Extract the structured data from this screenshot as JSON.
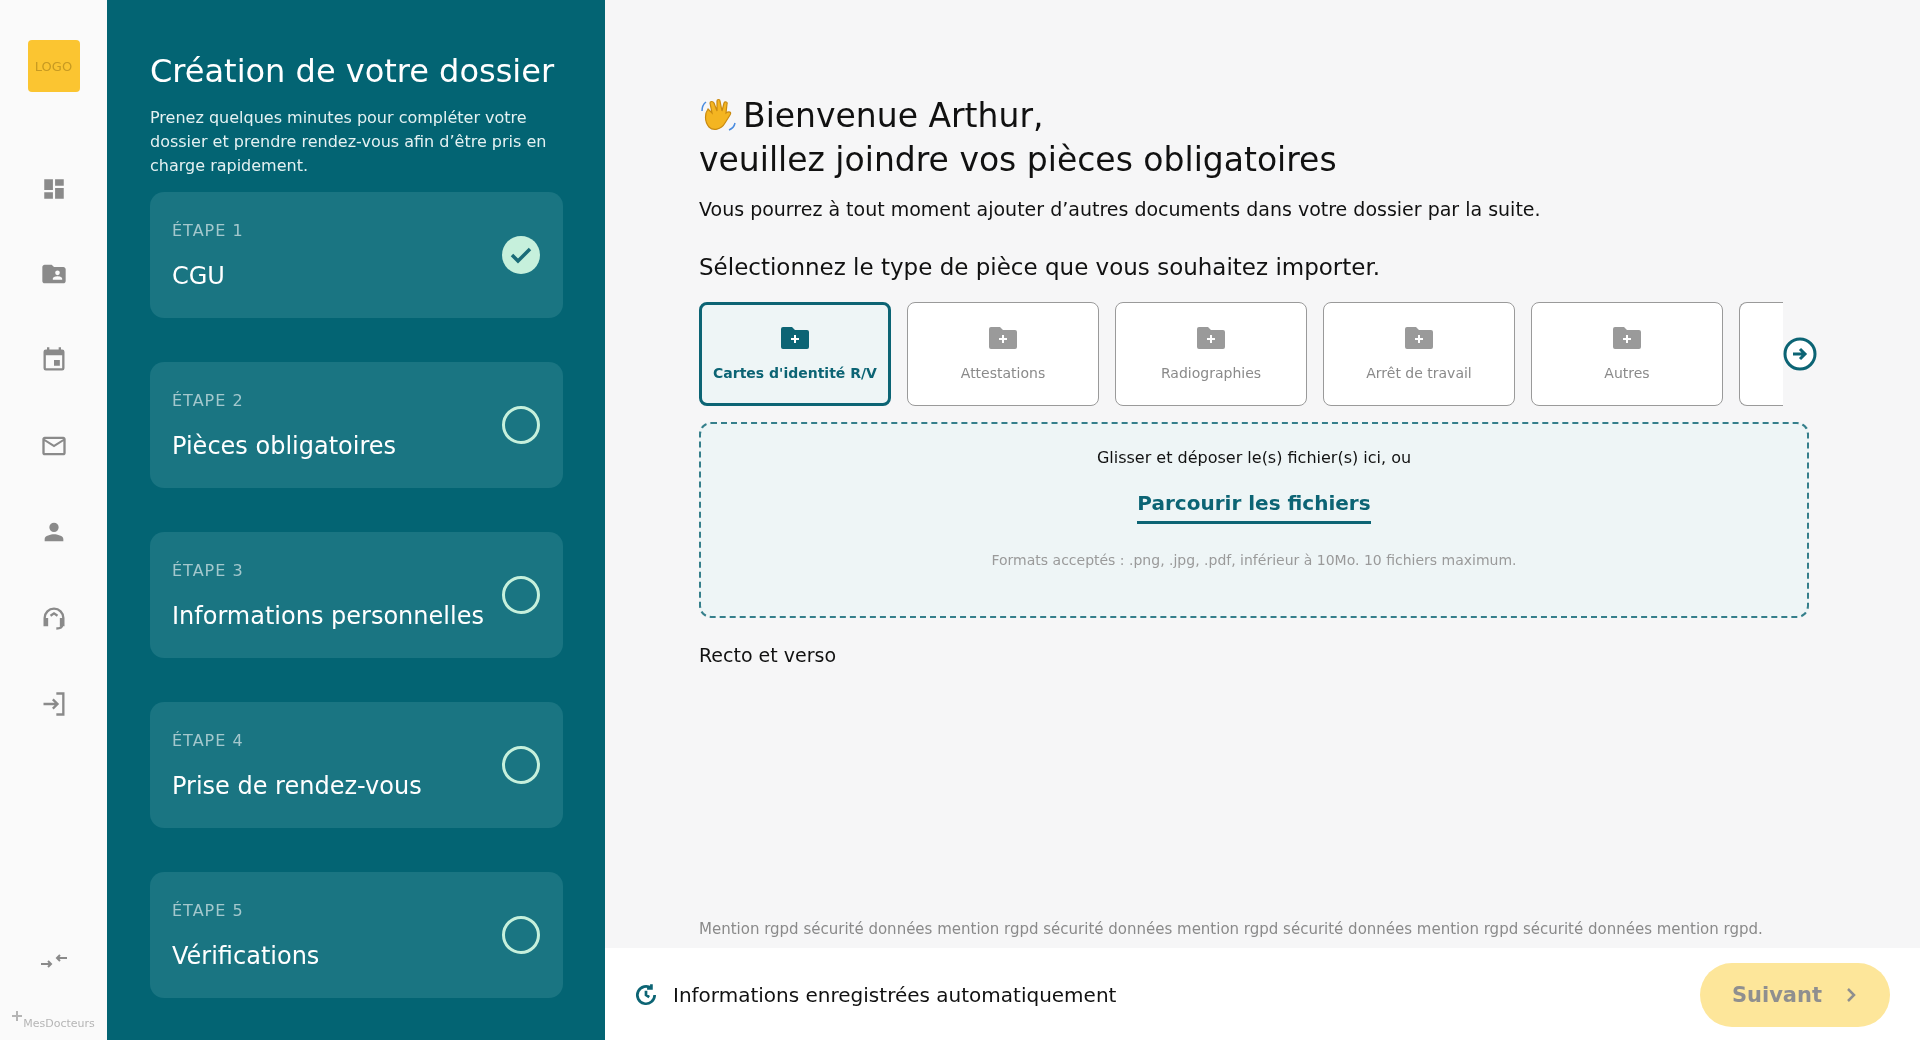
{
  "rail": {
    "logo": "LOGO",
    "brand": "MesDocteurs"
  },
  "steps_panel": {
    "title": "Création de votre dossier",
    "intro": "Prenez quelques minutes pour compléter votre dossier et prendre rendez-vous afin d’être pris en charge rapidement.",
    "steps": [
      {
        "label": "ÉTAPE 1",
        "name": "CGU",
        "checked": true
      },
      {
        "label": "ÉTAPE 2",
        "name": "Pièces obligatoires",
        "checked": false
      },
      {
        "label": "ÉTAPE 3",
        "name": "Informations personnelles",
        "checked": false
      },
      {
        "label": "ÉTAPE 4",
        "name": "Prise de rendez-vous",
        "checked": false
      },
      {
        "label": "ÉTAPE 5",
        "name": "Vérifications",
        "checked": false
      }
    ]
  },
  "main": {
    "greeting": "Bienvenue Arthur,",
    "heading": "veuillez joindre vos pièces obligatoires",
    "subtitle": "Vous pourrez à tout moment ajouter d’autres documents dans votre dossier par la suite.",
    "prompt": "Sélectionnez le type de pièce que vous souhaitez importer.",
    "doc_types": [
      {
        "label": "Cartes d'identité R/V",
        "selected": true
      },
      {
        "label": "Attestations",
        "selected": false
      },
      {
        "label": "Radiographies",
        "selected": false
      },
      {
        "label": "Arrêt de travail",
        "selected": false
      },
      {
        "label": "Autres",
        "selected": false
      }
    ],
    "dropzone": {
      "text": "Glisser et déposer le(s) fichier(s) ici, ou",
      "link": "Parcourir les fichiers",
      "formats": "Formats acceptés : .png, .jpg, .pdf, inférieur à 10Mo. 10 fichiers maximum."
    },
    "note": "Recto et verso",
    "rgpd": "Mention rgpd sécurité données mention rgpd sécurité données mention rgpd sécurité données mention rgpd sécurité données mention rgpd."
  },
  "footer": {
    "autosave": "Informations enregistrées automatiquement",
    "next_button": {
      "label": "Suivant",
      "disabled": true
    }
  }
}
